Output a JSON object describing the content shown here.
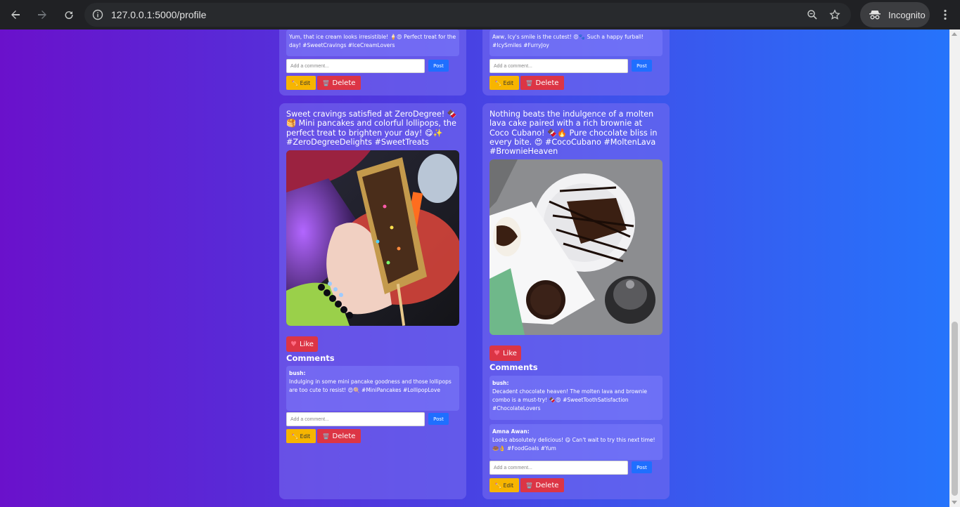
{
  "browser": {
    "url": "127.0.0.1:5000/profile",
    "profile_label": "Incognito"
  },
  "labels": {
    "comment_placeholder": "Add a comment...",
    "post": "Post",
    "edit": "Edit",
    "delete": "Delete",
    "like": "Like",
    "comments_heading": "Comments"
  },
  "posts_top": [
    {
      "comment_text": "Yum, that ice cream looks irresistible! 🍦😍 Perfect treat for the day! #SweetCravings #IceCreamLovers"
    },
    {
      "comment_text": "Aww, Icy's smile is the cutest! 😍🐾 Such a happy furball! #IcySmiles #FurryJoy"
    }
  ],
  "posts": [
    {
      "caption": "Sweet cravings satisfied at ZeroDegree! 🍫🥞 Mini pancakes and colorful lollipops, the perfect treat to brighten your day! 😋✨ #ZeroDegreeDelights #SweetTreats",
      "image": "mini-pancakes-photo",
      "comments": [
        {
          "author": "bush:",
          "text": "Indulging in some mini pancake goodness and those lollipops are too cute to resist! 😍🍭 #MiniPancakes #LollipopLove"
        }
      ]
    },
    {
      "caption": "Nothing beats the indulgence of a molten lava cake paired with a rich brownie at Coco Cubano! 🍫🔥 Pure chocolate bliss in every bite. 😍 #CocoCubano #MoltenLava #BrownieHeaven",
      "image": "lava-cake-brownie-photo",
      "comments": [
        {
          "author": "bush:",
          "text": "Decadent chocolate heaven! The molten lava and brownie combo is a must-try! 🍫😍 #SweetToothSatisfaction #ChocolateLovers"
        },
        {
          "author": "Amna Awan:",
          "text": "Looks absolutely delicious! 😋 Can't wait to try this next time! 🍩👌 #FoodGoals #Yum"
        }
      ]
    }
  ]
}
